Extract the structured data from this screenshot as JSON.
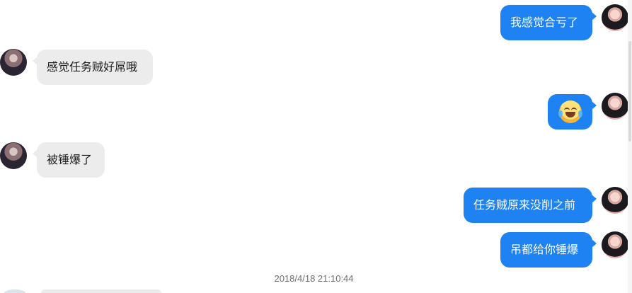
{
  "messages": [
    {
      "side": "right",
      "text": "我感觉合亏了"
    },
    {
      "side": "left",
      "text": "感觉任务贼好屌哦"
    },
    {
      "side": "right",
      "emoji": "face-with-tears-of-joy"
    },
    {
      "side": "left",
      "text": "被锤爆了"
    },
    {
      "side": "right",
      "text": "任务贼原来没削之前"
    },
    {
      "side": "right",
      "text": "吊都给你锤爆"
    }
  ],
  "timestamp": "2018/4/18 21:10:44",
  "colors": {
    "incoming_bubble": "#ececec",
    "outgoing_bubble": "#1f82f2",
    "outgoing_text": "#ffffff",
    "incoming_text": "#1d1d1d",
    "timestamp_text": "#6f6f6f"
  }
}
